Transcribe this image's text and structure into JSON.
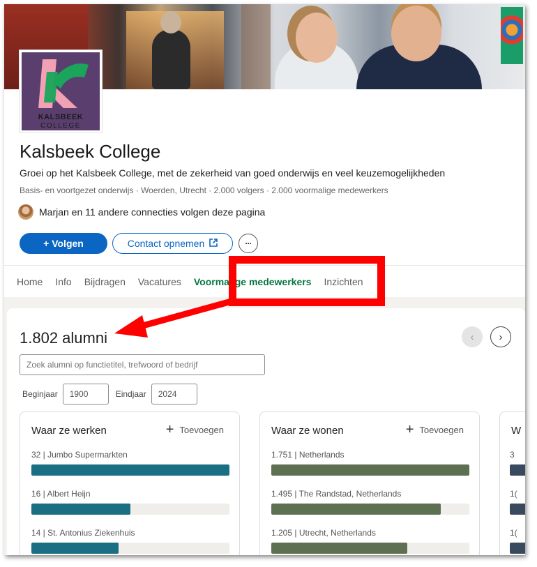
{
  "company": {
    "logo_line1": "KALSBEEK",
    "logo_line2": "COLLEGE",
    "name": "Kalsbeek College",
    "tagline": "Groei op het Kalsbeek College, met de zekerheid van goed onderwijs en veel keuzemogelijkheden",
    "meta": "Basis- en voortgezet onderwijs · Woerden, Utrecht · 2.000 volgers · 2.000 voormalige medewerkers",
    "connections": "Marjan en 11 andere connecties volgen deze pagina"
  },
  "actions": {
    "follow": "+ Volgen",
    "contact": "Contact opnemen",
    "contact_icon": "external-link-icon",
    "more": "···"
  },
  "tabs": [
    {
      "label": "Home",
      "active": false
    },
    {
      "label": "Info",
      "active": false
    },
    {
      "label": "Bijdragen",
      "active": false
    },
    {
      "label": "Vacatures",
      "active": false
    },
    {
      "label": "Voormalige medewerkers",
      "active": true
    },
    {
      "label": "Inzichten",
      "active": false
    }
  ],
  "alumni": {
    "count": "1.802 alumni",
    "prev": "‹",
    "next": "›",
    "search_placeholder": "Zoek alumni op functietitel, trefwoord of bedrijf",
    "start_label": "Beginjaar",
    "start_value": "1900",
    "end_label": "Eindjaar",
    "end_value": "2024"
  },
  "panels": [
    {
      "title": "Waar ze werken",
      "add": "Toevoegen",
      "color": "#1b6f82",
      "rows": [
        {
          "label": "32  | Jumbo Supermarkten",
          "fraction": 1.0
        },
        {
          "label": "16  | Albert Heijn",
          "fraction": 0.5
        },
        {
          "label": "14  | St. Antonius Ziekenhuis",
          "fraction": 0.44
        }
      ]
    },
    {
      "title": "Waar ze wonen",
      "add": "Toevoegen",
      "color": "#5e7052",
      "rows": [
        {
          "label": "1.751  | Netherlands",
          "fraction": 1.0
        },
        {
          "label": "1.495  | The Randstad, Netherlands",
          "fraction": 0.854
        },
        {
          "label": "1.205  | Utrecht, Netherlands",
          "fraction": 0.688
        }
      ]
    },
    {
      "title": "W",
      "color": "#3a4a5e",
      "rows": [
        {
          "label": "3",
          "fraction": 1.0
        },
        {
          "label": "1(",
          "fraction": 1.0
        },
        {
          "label": "1(",
          "fraction": 1.0
        }
      ]
    }
  ],
  "highlight_color": "#ff0000"
}
